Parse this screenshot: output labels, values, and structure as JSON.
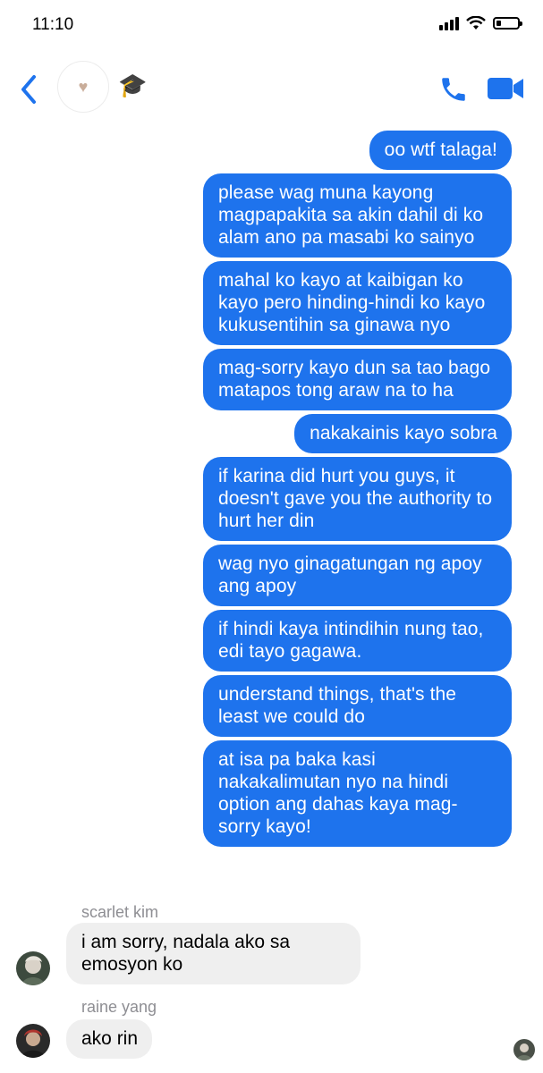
{
  "status_bar": {
    "time": "11:10",
    "battery_level": 0.2
  },
  "header": {
    "avatar_icon": "heart-icon",
    "contact_emoji": "🎓",
    "accent_color": "#1e73ed"
  },
  "messages_out": [
    "oo wtf talaga!",
    "please wag muna kayong magpapakita sa akin dahil di ko alam ano pa masabi ko sainyo",
    "mahal ko kayo at kaibigan ko kayo pero hinding-hindi ko kayo kukusentihin sa ginawa nyo",
    "mag-sorry kayo dun sa tao bago matapos tong araw na to ha",
    "nakakainis kayo sobra",
    "if karina did hurt you guys, it doesn't gave you the authority to hurt her din",
    "wag nyo ginagatungan ng apoy ang apoy",
    "if hindi kaya intindihin nung tao, edi tayo gagawa.",
    "understand things, that's the least we could do",
    "at isa pa baka kasi nakakalimutan nyo na hindi option ang dahas kaya mag-sorry kayo!"
  ],
  "incoming": [
    {
      "sender": "scarlet kim",
      "text": "i am sorry, nadala ako sa emosyon ko"
    },
    {
      "sender": "raine yang",
      "text": "ako rin"
    }
  ]
}
